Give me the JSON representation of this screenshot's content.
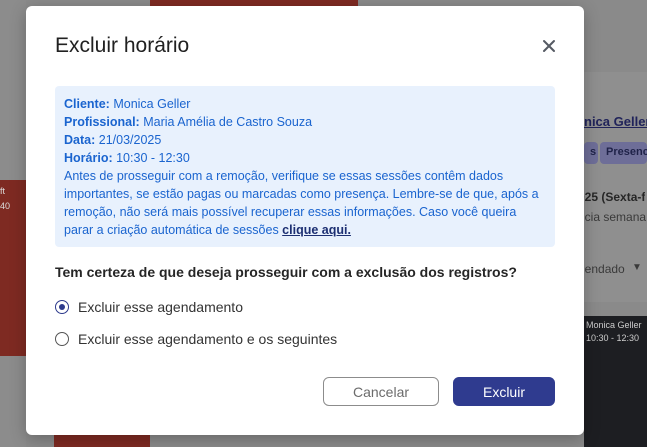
{
  "background": {
    "client_name_partial": "nica Geller",
    "status_pill_1": "s",
    "status_pill_2": "Presenc",
    "date_partial": "025 (Sexta-f",
    "recurrence_partial": "ncia semana",
    "status_select_partial": "gendado",
    "left_event_text_1": "ft",
    "left_event_text_2": "40",
    "dark_event_name": "Monica Geller",
    "dark_event_time": "10:30 - 12:30"
  },
  "modal": {
    "title": "Excluir horário",
    "close_icon": "close-icon",
    "info": {
      "client_label": "Cliente:",
      "client_value": "Monica Geller",
      "professional_label": "Profissional:",
      "professional_value": "Maria Amélia de Castro Souza",
      "date_label": "Data:",
      "date_value": "21/03/2025",
      "time_label": "Horário:",
      "time_value": "10:30 - 12:30",
      "warning_line_1": "Antes de prosseguir com a remoção, verifique se essas sessões contêm dados",
      "warning_line_2": "importantes, se estão pagas ou marcadas como presença. Lembre-se de que, após a",
      "warning_line_3": "remoção, não será mais possível recuperar essas informações. Caso você queira",
      "warning_line_4": "parar a criação automática de sessões ",
      "link_text": "clique aqui."
    },
    "question": "Tem certeza de que deseja prosseguir com a exclusão dos registros?",
    "options": [
      {
        "label": "Excluir esse agendamento",
        "checked": true
      },
      {
        "label": "Excluir esse agendamento e os seguintes",
        "checked": false
      }
    ],
    "cancel_label": "Cancelar",
    "delete_label": "Excluir"
  },
  "colors": {
    "primary": "#2f3b8f",
    "info_bg": "#e8f1fd",
    "info_text": "#1a64cf"
  }
}
